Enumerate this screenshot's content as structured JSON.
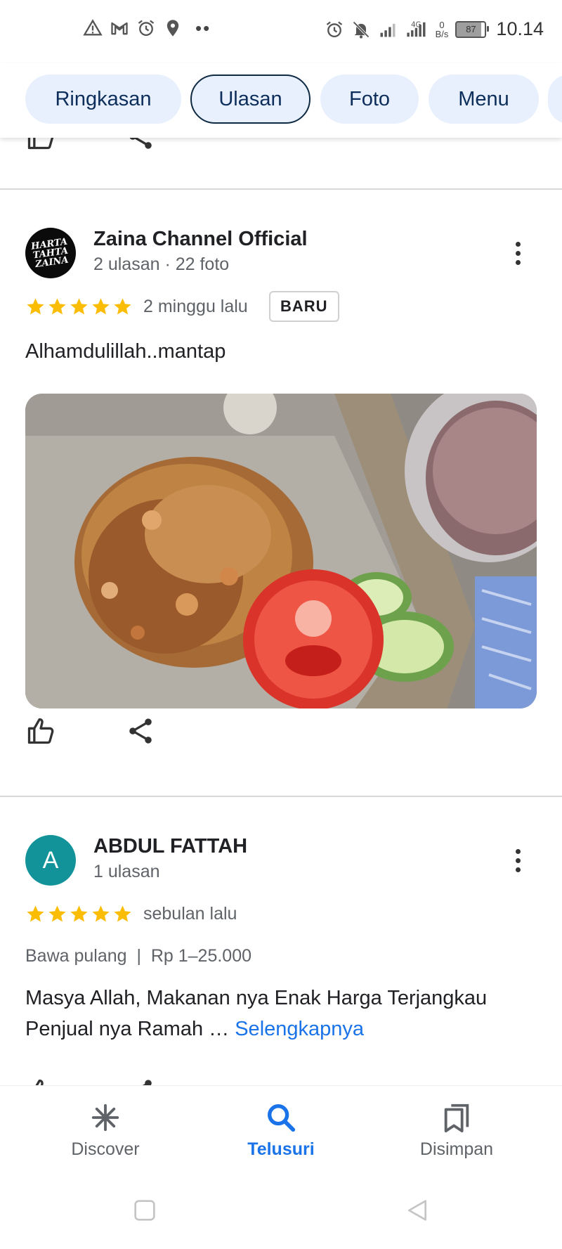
{
  "status_bar": {
    "left_icons": [
      "warning-icon",
      "gmail-icon",
      "alarm-icon",
      "location-icon",
      "more-dots-icon"
    ],
    "right_icons": [
      "alarm-icon",
      "bell-off-icon",
      "signal-icon",
      "signal-4g-icon"
    ],
    "network_speed_value": "0",
    "network_speed_unit": "B/s",
    "battery": "87",
    "time": "10.14"
  },
  "tabs": [
    {
      "label": "Ringkasan",
      "active": false
    },
    {
      "label": "Ulasan",
      "active": true
    },
    {
      "label": "Foto",
      "active": false
    },
    {
      "label": "Menu",
      "active": false
    }
  ],
  "reviews": [
    {
      "avatar_text_lines": [
        "HARTA",
        "TAHTA",
        "ZAINA"
      ],
      "name": "Zaina Channel Official",
      "meta": "2 ulasan · 22 foto",
      "rating": 5,
      "time": "2 minggu lalu",
      "badge": "BARU",
      "text": "Alhamdulillah..mantap",
      "photo_icon": "food-photo"
    },
    {
      "avatar_letter": "A",
      "avatar_color": "#12939a",
      "name": "ABDUL FATTAH",
      "meta": "1 ulasan",
      "rating": 5,
      "time": "sebulan lalu",
      "order_meta": "Bawa pulang  |  Rp 1–25.000",
      "text": "Masya Allah, Makanan nya Enak Harga Terjangkau Penjual nya Ramah … ",
      "more_link": "Selengkapnya"
    }
  ],
  "bottom_nav": [
    {
      "label": "Discover",
      "icon": "discover-icon",
      "active": false
    },
    {
      "label": "Telusuri",
      "icon": "search-icon",
      "active": true
    },
    {
      "label": "Disimpan",
      "icon": "saved-icon",
      "active": false
    }
  ],
  "colors": {
    "accent": "#1a73e8",
    "star": "#fbbc04",
    "tab_bg": "#e8f0fe",
    "divider": "#d7d7d7"
  }
}
